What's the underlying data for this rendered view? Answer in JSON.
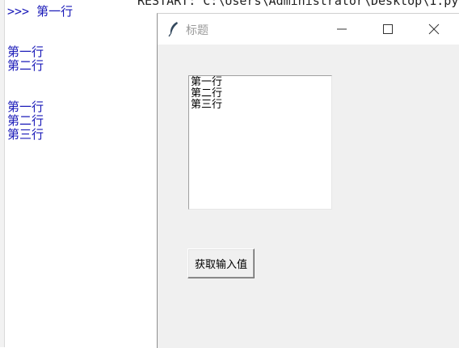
{
  "shell": {
    "top_text": "RESTART: C:\\Users\\Administrator\\Desktop\\1.py",
    "lines": [
      ">>> 第一行",
      "第一行",
      "第二行",
      "第一行",
      "第二行",
      "第三行"
    ]
  },
  "tk_window": {
    "title": "标题",
    "icon": "feather-icon",
    "controls": {
      "minimize": "minimize-icon",
      "maximize": "maximize-icon",
      "close": "close-icon"
    },
    "textbox_lines": [
      "第一行",
      "第二行",
      "第三行"
    ],
    "button_label": "获取输入值"
  },
  "colors": {
    "shell_text": "#1a1ab8",
    "window_bg": "#f0f0f0",
    "title_text": "#999999"
  }
}
